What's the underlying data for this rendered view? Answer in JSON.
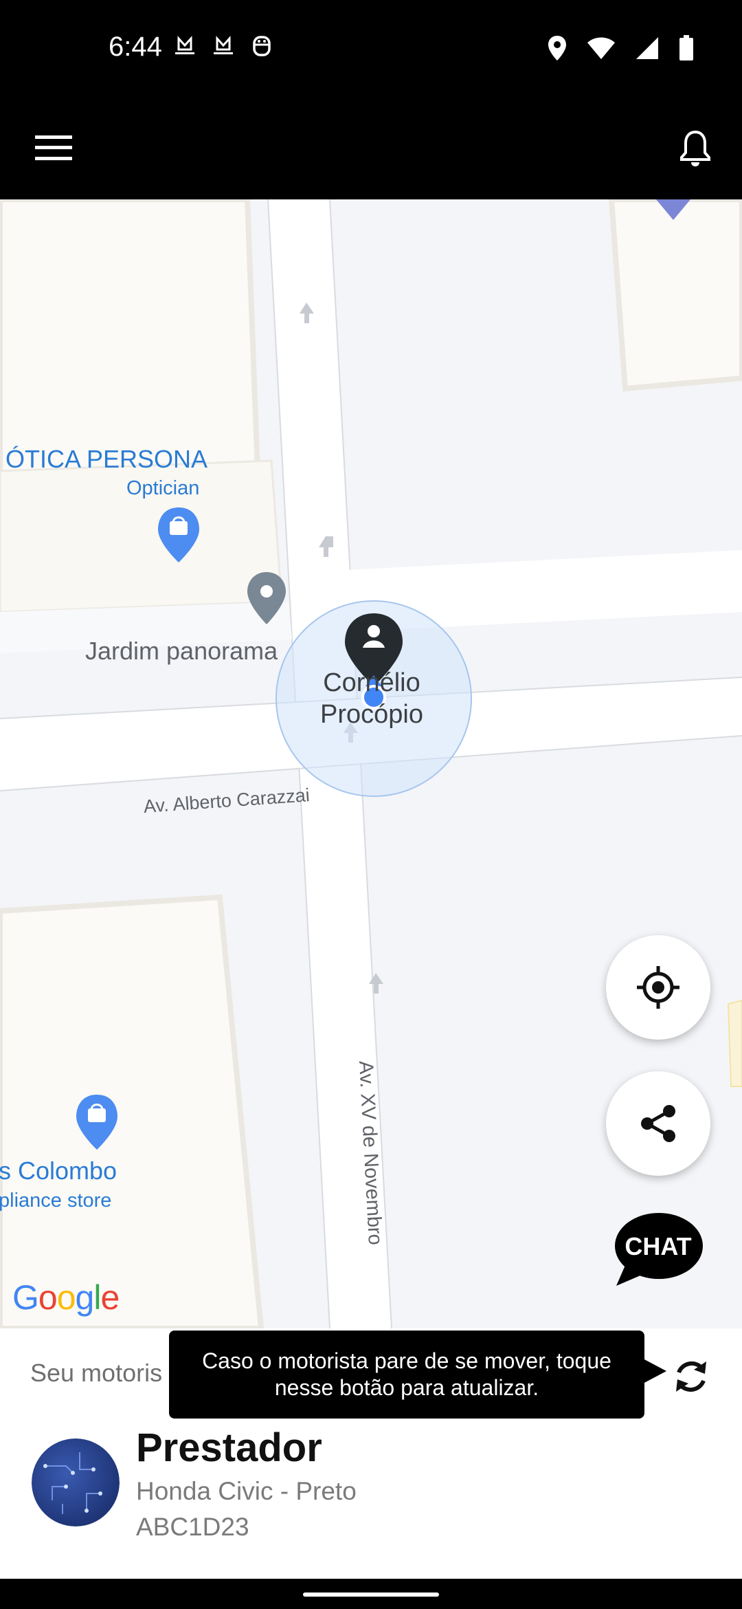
{
  "status_bar": {
    "time": "6:44",
    "left_icons": [
      "quickdrive-notification-icon",
      "quickdrive-notification-icon",
      "robot-notification-icon"
    ],
    "right_icons": [
      "location-icon",
      "wifi-icon",
      "signal-icon",
      "battery-icon"
    ]
  },
  "app_bar": {
    "menu_icon": "hamburger-menu-icon",
    "notifications_icon": "bell-icon"
  },
  "map": {
    "pois": [
      {
        "name": "ÓTICA PERSONA",
        "type": "Optician"
      },
      {
        "name": "s Colombo",
        "type": "pliance store"
      }
    ],
    "place": "Jardim panorama",
    "marker_label_line1": "Cornélio",
    "marker_label_line2": "Procópio",
    "street_horizontal": "Av. Alberto Carazzai",
    "street_vertical": "Av. XV de Novembro",
    "google_logo": "Google",
    "chat_label": "CHAT",
    "colors": {
      "poi_blue": "#4285f4",
      "accuracy_circle": "#d2e3fc",
      "location_dot": "#4285f4"
    }
  },
  "bottom_panel": {
    "status_text": "Seu motoris",
    "tooltip": "Caso o motorista pare de se mover, toque nesse botão para atualizar.",
    "provider_name": "Prestador",
    "vehicle": "Honda Civic - Preto",
    "plate": "ABC1D23"
  }
}
